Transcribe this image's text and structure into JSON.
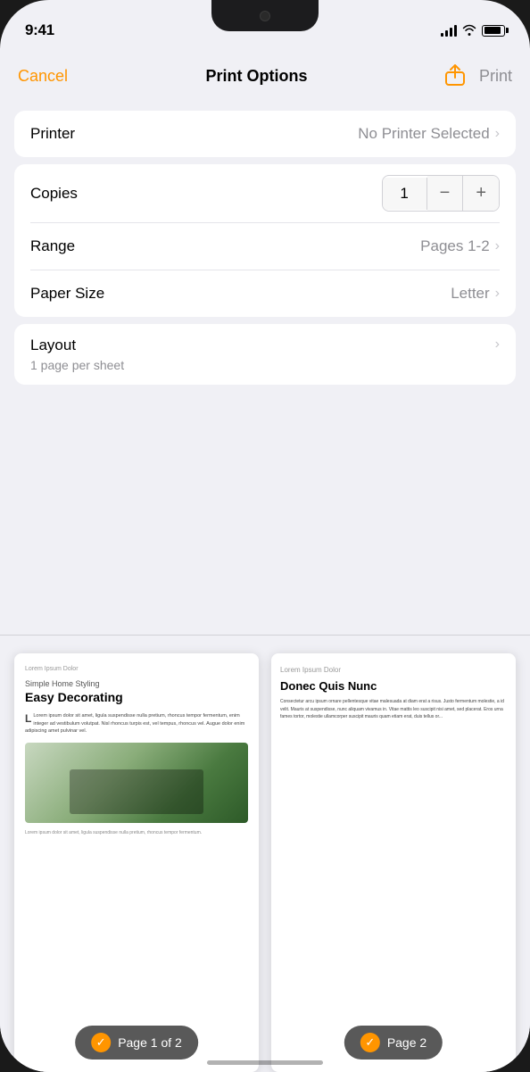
{
  "statusBar": {
    "time": "9:41",
    "batteryLevel": 90
  },
  "header": {
    "cancel": "Cancel",
    "title": "Print Options",
    "print": "Print"
  },
  "printer": {
    "label": "Printer",
    "value": "No Printer Selected"
  },
  "copies": {
    "label": "Copies",
    "value": "1",
    "decrement": "−",
    "increment": "+"
  },
  "range": {
    "label": "Range",
    "value": "Pages 1-2"
  },
  "paperSize": {
    "label": "Paper Size",
    "value": "Letter"
  },
  "layout": {
    "label": "Layout",
    "subtitle": "1 page per sheet"
  },
  "preview": {
    "page1": {
      "smallText": "Lorem Ipsum Dolor",
      "subtitle": "Simple Home Styling",
      "title": "Easy Decorating",
      "bodyText": "Lorem ipsum dolor sit amet, ligula suspendisse nulla pretium, rhoncus tempor fermentum, enim integer ad vestibulum volutpat. Nisl rhoncus turpis est, vel tempus, rhoncus vel. Augue dolor enim adipiscing amet pulvinar vel.",
      "caption": "Lorem ipsum dolor sit amet, ligula suspendisse nulla pretium, rhoncus tempor fermentum.",
      "indicator": "Page 1 of 2"
    },
    "page2": {
      "smallText": "Lorem Ipsum Dolor",
      "title": "Donec Quis Nunc",
      "bodyText": "Consectetur arcu ipsum ornare pellentesque vitae malesuada at diam erat a risus. Justo fermentum molestie, a id velit. Mauris at suspendisse, nunc aliquam vivamus in. Vitae mattis leo suscipit nisi amet, sed placerat. Eros urna fames tortor, molestie ullamcorper suscipit mauris quam etiam erat, duis tellus or...",
      "indicator": "Page 2"
    }
  }
}
